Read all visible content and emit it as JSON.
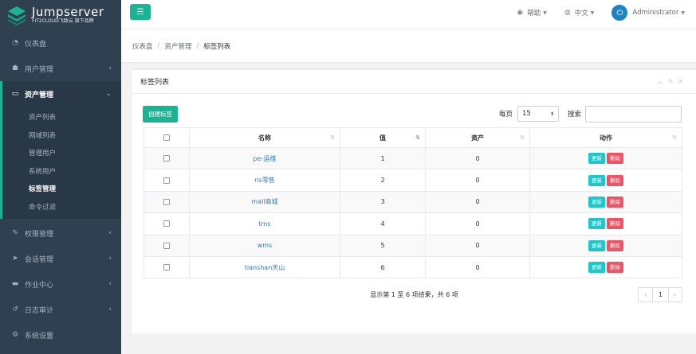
{
  "brand": {
    "title": "Jumpserver",
    "subtitle": "FIT2CLOUD飞致云 旗下品牌"
  },
  "sidebar": {
    "items": [
      {
        "label": "仪表盘",
        "icon": "dashboard-icon"
      },
      {
        "label": "用户管理",
        "icon": "users-icon"
      },
      {
        "label": "资产管理",
        "icon": "assets-icon"
      },
      {
        "label": "权限管理",
        "icon": "permission-icon"
      },
      {
        "label": "会话管理",
        "icon": "session-icon"
      },
      {
        "label": "作业中心",
        "icon": "job-icon"
      },
      {
        "label": "日志审计",
        "icon": "audit-icon"
      },
      {
        "label": "系统设置",
        "icon": "settings-icon"
      }
    ],
    "submenu": [
      "资产列表",
      "网域列表",
      "管理用户",
      "系统用户",
      "标签管理",
      "命令过滤"
    ]
  },
  "topbar": {
    "help": "帮助",
    "lang": "中文",
    "user": "Administrator"
  },
  "breadcrumb": [
    "仪表盘",
    "资产管理",
    "标签列表"
  ],
  "panel": {
    "title": "标签列表"
  },
  "toolbar": {
    "create": "创建标签",
    "page_size_label": "每页",
    "page_size": "15",
    "search_label": "搜索",
    "search_value": ""
  },
  "table": {
    "headers": [
      "名称",
      "值",
      "资产",
      "动作"
    ],
    "rows": [
      {
        "name": "pe-运维",
        "value": "1",
        "assets": "0"
      },
      {
        "name": "ris零售",
        "value": "2",
        "assets": "0"
      },
      {
        "name": "mall商城",
        "value": "3",
        "assets": "0"
      },
      {
        "name": "tms",
        "value": "4",
        "assets": "0"
      },
      {
        "name": "wms",
        "value": "5",
        "assets": "0"
      },
      {
        "name": "tianshan天山",
        "value": "6",
        "assets": "0"
      }
    ],
    "update_label": "更新",
    "delete_label": "删除"
  },
  "pagination": {
    "info": "显示第 1 至 6 项结果，共 6 项",
    "prev": "‹",
    "page": "1",
    "next": "›"
  },
  "colors": {
    "sidebar": "#2f4050",
    "accent": "#1ab394",
    "update": "#23c6c8",
    "delete": "#ed5565",
    "link": "#337ab7"
  }
}
